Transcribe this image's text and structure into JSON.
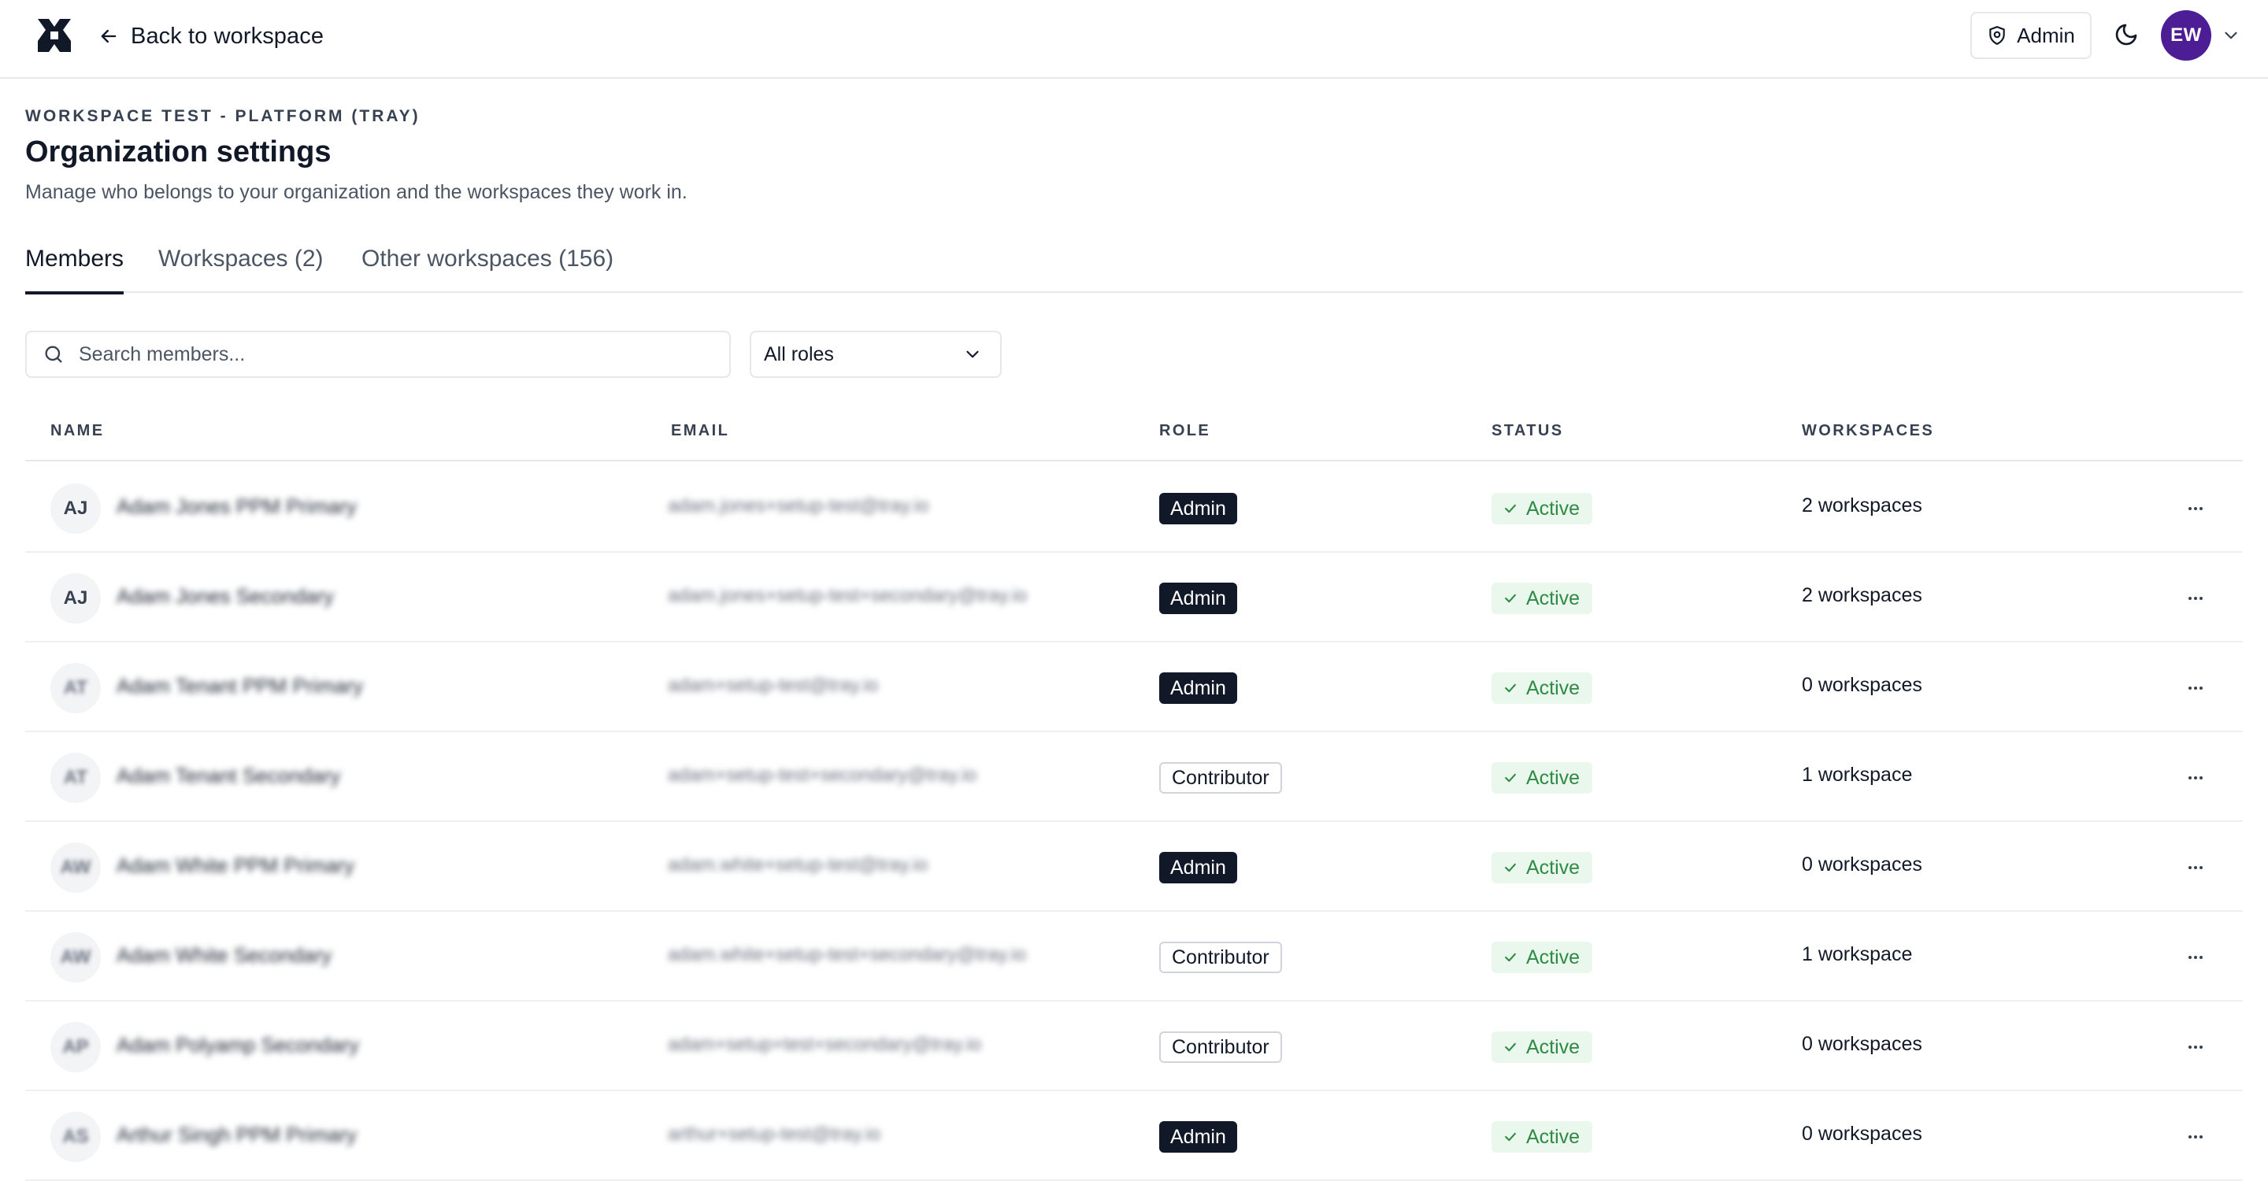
{
  "topbar": {
    "back_label": "Back to workspace",
    "admin_label": "Admin",
    "avatar_initials": "EW",
    "avatar_color": "#4c1d95"
  },
  "header": {
    "eyebrow": "WORKSPACE TEST - PLATFORM (TRAY)",
    "title": "Organization settings",
    "subtitle": "Manage who belongs to your organization and the workspaces they work in."
  },
  "tabs": [
    {
      "label": "Members",
      "active": true
    },
    {
      "label": "Workspaces (2)",
      "active": false
    },
    {
      "label": "Other workspaces (156)",
      "active": false
    }
  ],
  "filters": {
    "search_placeholder": "Search members...",
    "role_value": "All roles"
  },
  "table": {
    "columns": [
      "NAME",
      "EMAIL",
      "ROLE",
      "STATUS",
      "WORKSPACES"
    ],
    "rows": [
      {
        "initials": "AJ",
        "name": "Adam Jones PPM Primary",
        "email": "adam.jones+setup-test@tray.io",
        "role": "Admin",
        "status": "Active",
        "workspaces": "2 workspaces"
      },
      {
        "initials": "AJ",
        "name": "Adam Jones Secondary",
        "email": "adam.jones+setup-test+secondary@tray.io",
        "role": "Admin",
        "status": "Active",
        "workspaces": "2 workspaces"
      },
      {
        "initials": "AT",
        "name": "Adam Tenant PPM Primary",
        "email": "adam+setup-test@tray.io",
        "role": "Admin",
        "status": "Active",
        "workspaces": "0 workspaces"
      },
      {
        "initials": "AT",
        "name": "Adam Tenant Secondary",
        "email": "adam+setup-test+secondary@tray.io",
        "role": "Contributor",
        "status": "Active",
        "workspaces": "1 workspace"
      },
      {
        "initials": "AW",
        "name": "Adam White PPM Primary",
        "email": "adam.white+setup-test@tray.io",
        "role": "Admin",
        "status": "Active",
        "workspaces": "0 workspaces"
      },
      {
        "initials": "AW",
        "name": "Adam White Secondary",
        "email": "adam.white+setup-test+secondary@tray.io",
        "role": "Contributor",
        "status": "Active",
        "workspaces": "1 workspace"
      },
      {
        "initials": "AP",
        "name": "Adam Polyamp Secondary",
        "email": "adam+setup+test+secondary@tray.io",
        "role": "Contributor",
        "status": "Active",
        "workspaces": "0 workspaces"
      },
      {
        "initials": "AS",
        "name": "Arthur Singh PPM Primary",
        "email": "arthur+setup-test@tray.io",
        "role": "Admin",
        "status": "Active",
        "workspaces": "0 workspaces"
      }
    ]
  },
  "colors": {
    "status_bg": "#e9f7ec",
    "status_text": "#2f8a46",
    "admin_badge_bg": "#111827"
  }
}
